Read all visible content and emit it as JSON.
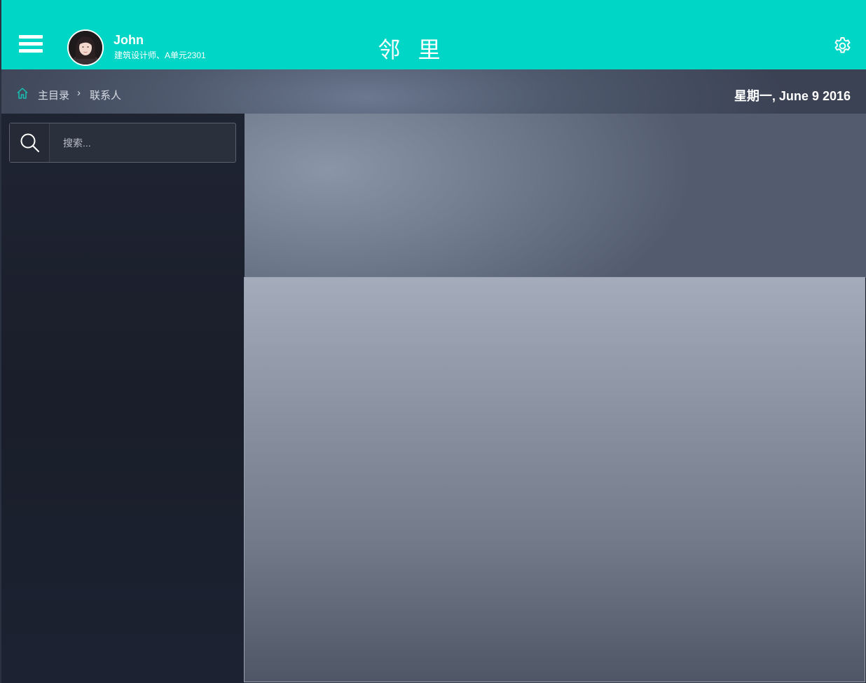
{
  "header": {
    "menu_icon": "hamburger-menu-icon",
    "user": {
      "name": "John",
      "subtitle": "建筑设计师、A单元2301",
      "avatar_icon": "user-avatar"
    },
    "title": "邻 里",
    "settings_icon": "gear-icon",
    "accent_color": "#00d6c6"
  },
  "breadcrumb": {
    "home_icon": "home-icon",
    "items": [
      "主目录",
      "联系人"
    ],
    "separator": "›"
  },
  "date": "星期一, June 9  2016",
  "sidebar": {
    "search": {
      "icon": "search-icon",
      "placeholder": "搜索..."
    }
  }
}
